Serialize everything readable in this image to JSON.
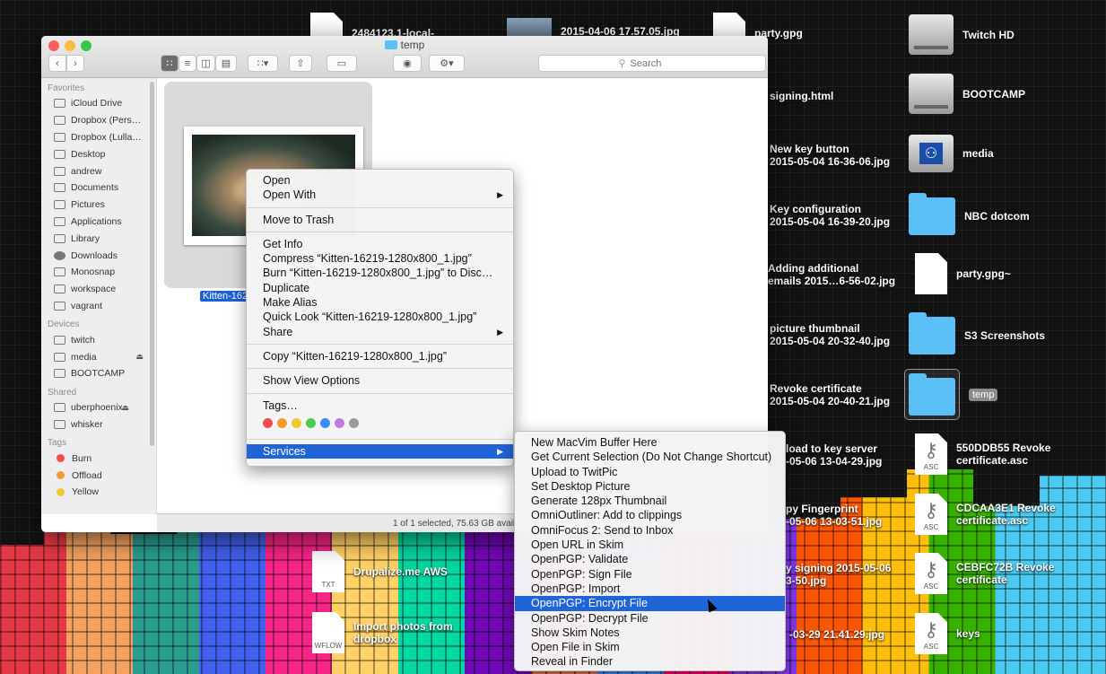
{
  "desktop": {
    "items_left": [
      {
        "label": "2484123.1-local-",
        "kind": "doc"
      },
      {
        "label": "2015-04-06 17.57.05.jpg",
        "kind": "image"
      },
      {
        "label": "party.gpg",
        "kind": "doc"
      },
      {
        "label": "signing.html",
        "kind": "doc"
      },
      {
        "label": "New key button",
        "label2": "2015-05-04 16-36-06.jpg"
      },
      {
        "label": "Key configuration",
        "label2": "2015-05-04 16-39-20.jpg"
      },
      {
        "label": "Adding additional",
        "label2": "emails 2015…6-56-02.jpg"
      },
      {
        "label": "picture thumbnail",
        "label2": "2015-05-04 20-32-40.jpg"
      },
      {
        "label": "Revoke certificate",
        "label2": "2015-05-04 20-40-21.jpg"
      },
      {
        "label": "load to key server",
        "label2": "-05-06 13-04-29.jpg"
      },
      {
        "label": "py Fingerprint",
        "label2": "-05-06 13-03-51.jpg"
      },
      {
        "label": "y signing 2015-05-06",
        "label2": "3-50.jpg"
      },
      {
        "label": "-03-29 21.41.29.jpg"
      }
    ],
    "items_right": [
      {
        "label": "Twitch HD"
      },
      {
        "label": "BOOTCAMP"
      },
      {
        "label": "media"
      },
      {
        "label": "NBC dotcom"
      },
      {
        "label": "party.gpg~"
      },
      {
        "label": "S3 Screenshots"
      },
      {
        "label": "temp"
      },
      {
        "label": "550DDB55 Revoke",
        "label2": "certificate.asc",
        "ext": "ASC"
      },
      {
        "label": "CDCAA3E1 Revoke",
        "label2": "certificate.asc",
        "ext": "ASC"
      },
      {
        "label": "CEBFC72B Revoke",
        "label2": "certificate",
        "ext": "ASC"
      },
      {
        "label": "keys",
        "ext": "ASC"
      }
    ],
    "items_bottom": [
      {
        "label": "Drupalize.me AWS",
        "ext": "TXT"
      },
      {
        "label": "Import photos from",
        "label2": "dropbox",
        "ext": "WFLOW"
      }
    ]
  },
  "finder": {
    "title": "temp",
    "search_placeholder": "Search",
    "status": "1 of 1 selected, 75.63 GB available",
    "selected_file": "Kitten-162",
    "sidebar": {
      "favorites_header": "Favorites",
      "favorites": [
        "iCloud Drive",
        "Dropbox (Pers…",
        "Dropbox (Lulla…",
        "Desktop",
        "andrew",
        "Documents",
        "Pictures",
        "Applications",
        "Library",
        "Downloads",
        "Monosnap",
        "workspace",
        "vagrant"
      ],
      "devices_header": "Devices",
      "devices": [
        "twitch",
        "media",
        "BOOTCAMP"
      ],
      "shared_header": "Shared",
      "shared": [
        "uberphoenix",
        "whisker"
      ],
      "tags_header": "Tags",
      "tags": [
        {
          "label": "Burn",
          "color": "#f24d4d"
        },
        {
          "label": "Offload",
          "color": "#f59a2f"
        },
        {
          "label": "Yellow",
          "color": "#f2c830"
        }
      ]
    }
  },
  "context_menu": {
    "open": "Open",
    "open_with": "Open With",
    "move_to_trash": "Move to Trash",
    "get_info": "Get Info",
    "compress": "Compress “Kitten-16219-1280x800_1.jpg”",
    "burn": "Burn “Kitten-16219-1280x800_1.jpg” to Disc…",
    "duplicate": "Duplicate",
    "make_alias": "Make Alias",
    "quick_look": "Quick Look “Kitten-16219-1280x800_1.jpg”",
    "share": "Share",
    "copy": "Copy “Kitten-16219-1280x800_1.jpg”",
    "show_view_options": "Show View Options",
    "tags": "Tags…",
    "tag_colors": [
      "#f24d4d",
      "#f59a2f",
      "#f2c830",
      "#4fc94f",
      "#3a8df2",
      "#c07ae0",
      "#9b9b9b"
    ],
    "services": "Services"
  },
  "services_menu": {
    "items": [
      "New MacVim Buffer Here",
      "Get Current Selection (Do Not Change Shortcut)",
      "Upload to TwitPic",
      "Set Desktop Picture",
      "Generate 128px Thumbnail",
      "OmniOutliner: Add to clippings",
      "OmniFocus 2: Send to Inbox",
      "Open URL in Skim",
      "OpenPGP: Validate",
      "OpenPGP: Sign File",
      "OpenPGP: Import",
      "OpenPGP: Encrypt File",
      "OpenPGP: Decrypt File",
      "Show Skim Notes",
      "Open File in Skim",
      "Reveal in Finder"
    ],
    "highlighted_index": 11
  },
  "colors": {
    "accent": "#1f65d8",
    "folder": "#5ac0f7"
  }
}
